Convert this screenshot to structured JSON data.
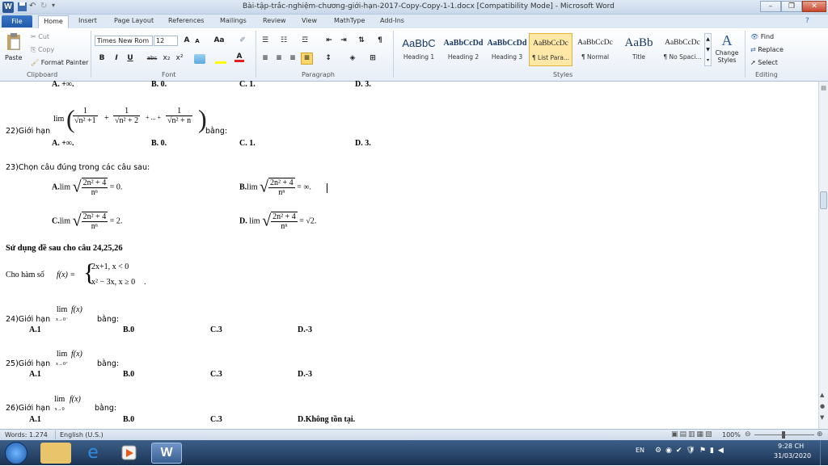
{
  "window": {
    "title": "Bài-tập-trắc-nghiệm-chương-giới-hạn-2017-Copy-Copy-1-1.docx [Compatibility Mode] - Microsoft Word",
    "app_logo": "W"
  },
  "tabs": [
    "File",
    "Home",
    "Insert",
    "Page Layout",
    "References",
    "Mailings",
    "Review",
    "View",
    "MathType",
    "Add-Ins"
  ],
  "clipboard": {
    "paste": "Paste",
    "cut": "Cut",
    "copy": "Copy",
    "format_painter": "Format Painter",
    "group": "Clipboard"
  },
  "font": {
    "name": "Times New Rom",
    "size": "12",
    "group": "Font",
    "bold": "B",
    "italic": "I",
    "underline": "U",
    "strike": "abc",
    "sub": "x₂",
    "sup": "x²",
    "grow": "A",
    "shrink": "A",
    "case": "Aa"
  },
  "paragraph": {
    "group": "Paragraph",
    "pilcrow": "¶"
  },
  "styles": {
    "group": "Styles",
    "items": [
      {
        "sample": "AaBbC",
        "label": "Heading 1"
      },
      {
        "sample": "AaBbCcDd",
        "label": "Heading 2"
      },
      {
        "sample": "AaBbCcDd",
        "label": "Heading 3"
      },
      {
        "sample": "AaBbCcDc",
        "label": "¶ List Para..."
      },
      {
        "sample": "AaBbCcDc",
        "label": "¶ Normal"
      },
      {
        "sample": "AaBb",
        "label": "Title"
      },
      {
        "sample": "AaBbCcDc",
        "label": "¶ No Spaci..."
      }
    ],
    "change": "Change Styles"
  },
  "editing": {
    "group": "Editing",
    "find": "Find",
    "replace": "Replace",
    "select": "Select"
  },
  "doc": {
    "top_row": {
      "a": "A. +∞.",
      "b": "B. 0.",
      "c": "C. 1.",
      "d": "D. 3."
    },
    "q22": {
      "prefix": "22)Giới hạn",
      "lim": "lim",
      "t1n": "1",
      "t1d": "√n² +1",
      "t2n": "1",
      "t2d": "√n² + 2",
      "dots": "+ ... +",
      "t3n": "1",
      "t3d": "√n² + n",
      "suffix": "bằng:",
      "a": "A. +∞.",
      "b": "B. 0.",
      "c": "C. 1.",
      "d": "D. 3."
    },
    "q23": {
      "prefix": "23)Chọn câu đúng trong các câu sau:",
      "a_label": "A.",
      "b_label": "B.",
      "c_label": "C.",
      "d_label": "D.",
      "lim": "lim",
      "num": "2n² + 4",
      "den": "nⁿ",
      "a_tail": "= 0.",
      "b_tail": "= ∞.",
      "c_tail": "= 2.",
      "d_tail": "= √2."
    },
    "section": "Sử dụng đề sau cho câu 24,25,26",
    "func": {
      "prefix": "Cho hàm số",
      "fx": "f(x) =",
      "case1": "2x+1, x < 0",
      "case2": "x² − 3x, x ≥ 0",
      "tail": "."
    },
    "q24": {
      "prefix": "24)Giới hạn",
      "lim": "lim",
      "sub": "x→0⁻",
      "f": "f(x)",
      "suffix": "bằng:",
      "a": "A.1",
      "b": "B.0",
      "c": "C.3",
      "d": "D.-3"
    },
    "q25": {
      "prefix": "25)Giới hạn",
      "lim": "lim",
      "sub": "x→0⁺",
      "f": "f(x)",
      "suffix": "bằng:",
      "a": "A.1",
      "b": "B.0",
      "c": "C.3",
      "d": "D.-3"
    },
    "q26": {
      "prefix": "26)Giới hạn",
      "lim": "lim",
      "sub": "x→0",
      "f": "f(x)",
      "suffix": "bằng:",
      "a": "A.1",
      "b": "B.0",
      "c": "C.3",
      "d": "D.Không tồn tại."
    }
  },
  "status": {
    "words": "Words: 1.274",
    "lang": "English (U.S.)",
    "zoom": "100%"
  },
  "tray": {
    "lang": "EN",
    "time": "9:28 CH",
    "date": "31/03/2020"
  }
}
